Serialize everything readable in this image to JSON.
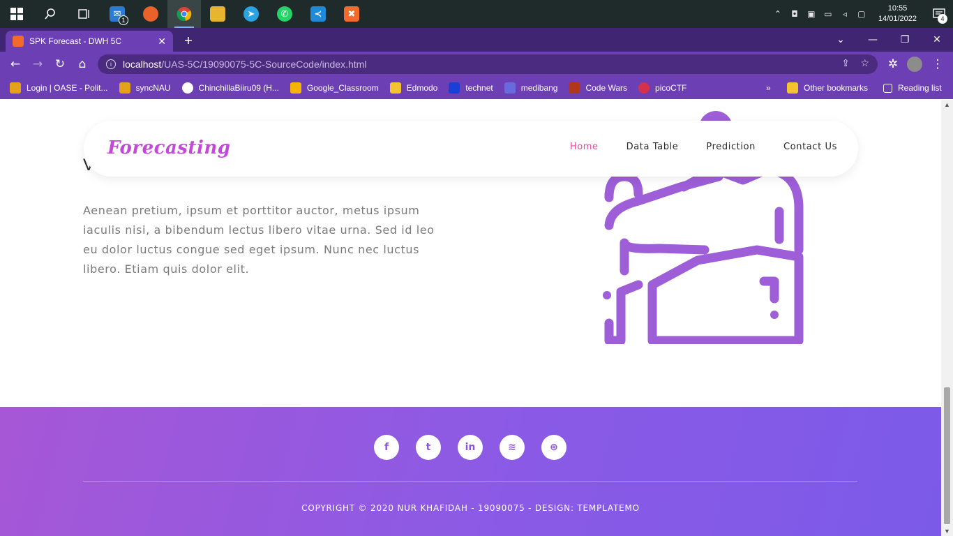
{
  "taskbar": {
    "apps": [
      {
        "name": "start",
        "label": "⊞",
        "color": "#1f2a2b"
      },
      {
        "name": "search",
        "label": "⌕",
        "color": "#1f2a2b"
      },
      {
        "name": "task-view",
        "label": "⧉",
        "color": "#1f2a2b"
      },
      {
        "name": "mail",
        "label": "✉",
        "color": "#2b7bd4",
        "badge": "1"
      },
      {
        "name": "firefox",
        "label": "◉",
        "color": "#e8622a"
      },
      {
        "name": "chrome",
        "label": "◎",
        "color": "#3d9a4a",
        "active": true
      },
      {
        "name": "file-explorer",
        "label": "▤",
        "color": "#e8b531"
      },
      {
        "name": "telegram",
        "label": "➤",
        "color": "#2aa3e0"
      },
      {
        "name": "whatsapp",
        "label": "✆",
        "color": "#25d366"
      },
      {
        "name": "vscode",
        "label": "⟨⟩",
        "color": "#1f8ad8"
      },
      {
        "name": "xampp",
        "label": "✖",
        "color": "#f26b2a"
      }
    ],
    "clock_time": "10:55",
    "clock_date": "14/01/2022",
    "notification_count": "4"
  },
  "browser": {
    "tab_title": "SPK Forecast - DWH 5C",
    "url_host": "localhost",
    "url_path": "/UAS-5C/19090075-5C-SourceCode/index.html",
    "bookmarks": [
      {
        "label": "Login | OASE - Polit...",
        "color": "#e3a21a"
      },
      {
        "label": "syncNAU",
        "color": "#e3a21a"
      },
      {
        "label": "ChinchillaBiiru09 (H...",
        "color": "#ffffff"
      },
      {
        "label": "Google_Classroom",
        "color": "#f4b400"
      },
      {
        "label": "Edmodo",
        "color": "#f4c430"
      },
      {
        "label": "technet",
        "color": "#1a3ed6"
      },
      {
        "label": "medibang",
        "color": "#6a6adf"
      },
      {
        "label": "Code Wars",
        "color": "#b1361e"
      },
      {
        "label": "picoCTF",
        "color": "#d6304a"
      }
    ],
    "more_bookmarks": "»",
    "other_bookmarks": "Other bookmarks",
    "reading_list": "Reading list"
  },
  "page": {
    "brand": "Forecasting",
    "nav": [
      "Home",
      "Data Table",
      "Prediction",
      "Contact Us"
    ],
    "heading_peek": "V",
    "paragraph": "Aenean pretium, ipsum et porttitor auctor, metus ipsum iaculis nisi, a bibendum lectus libero vitae urna. Sed id leo eu dolor luctus congue sed eget ipsum. Nunc nec luctus libero. Etiam quis dolor elit.",
    "socials": [
      {
        "name": "facebook",
        "glyph": "f"
      },
      {
        "name": "twitter",
        "glyph": "t"
      },
      {
        "name": "linkedin",
        "glyph": "in"
      },
      {
        "name": "rss",
        "glyph": "≋"
      },
      {
        "name": "dribbble",
        "glyph": "⊛"
      }
    ],
    "copyright": "COPYRIGHT © 2020 NUR KHAFIDAH - 19090075 - DESIGN: TEMPLATEMO"
  },
  "colors": {
    "accent": "#e9479c",
    "brand": "#c349d9",
    "illustration": "#9d5ed8",
    "chrome": "#6d3fb4"
  }
}
